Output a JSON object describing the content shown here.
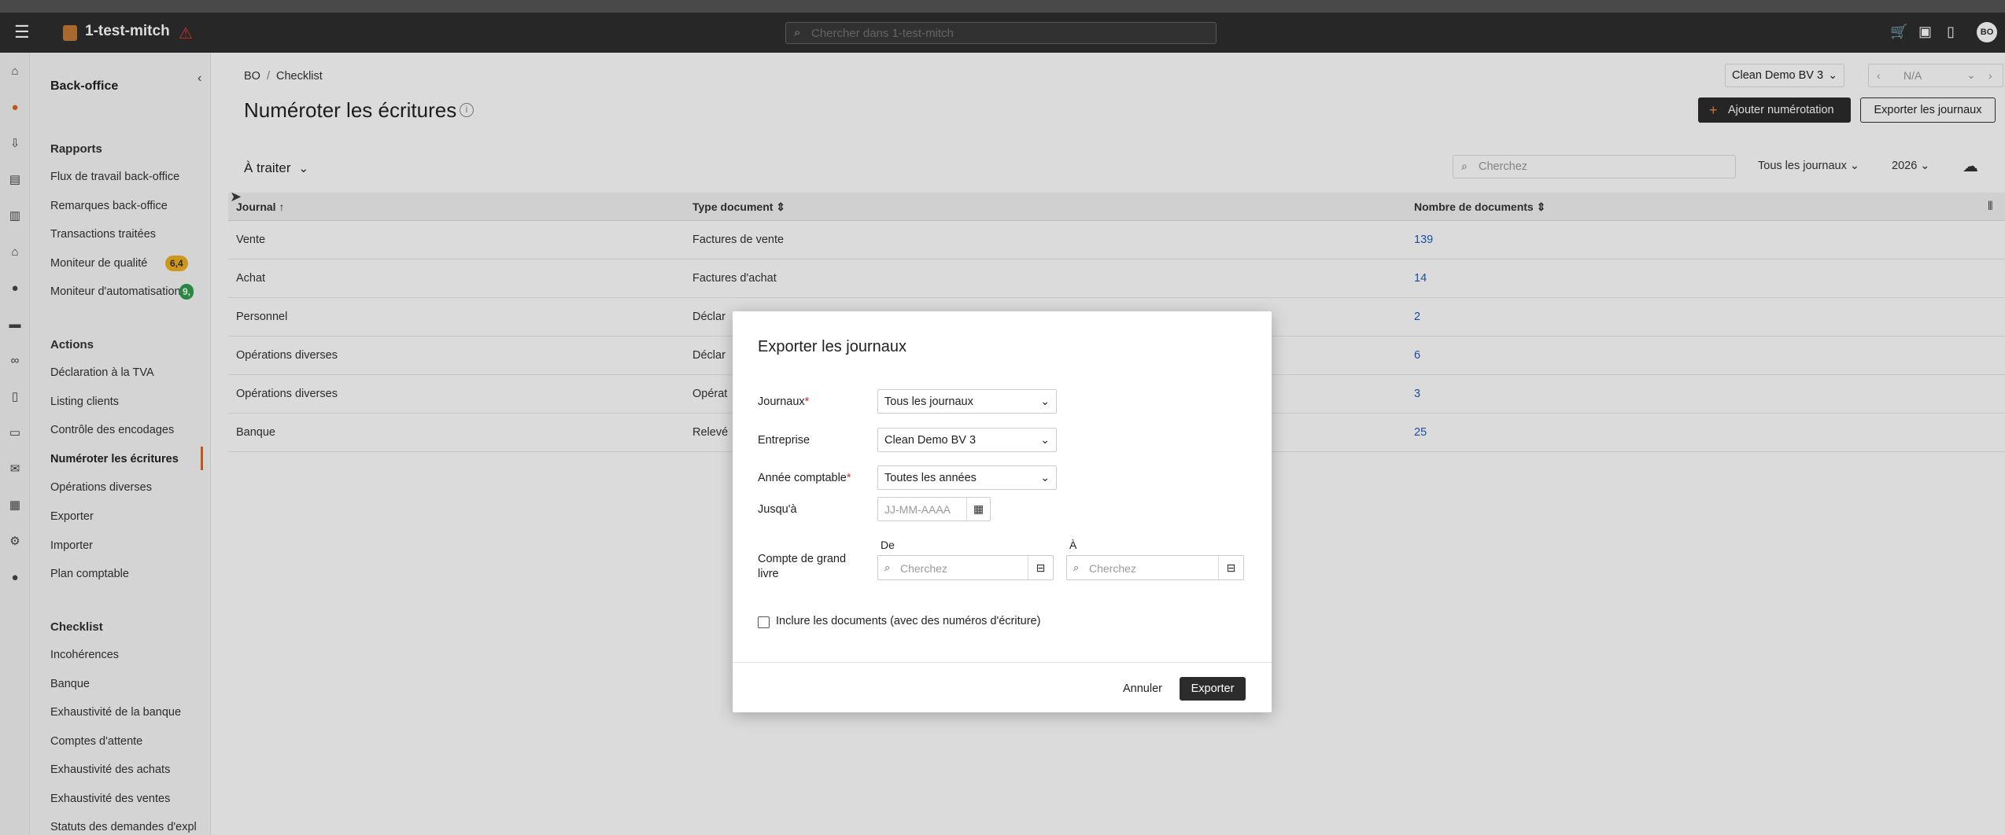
{
  "header": {
    "company_name": "1-test-mitch",
    "search_placeholder": "Chercher dans 1-test-mitch",
    "avatar_initials": "BO"
  },
  "sidebar": {
    "title": "Back-office",
    "sections": {
      "rapports": "Rapports",
      "actions": "Actions",
      "checklist": "Checklist"
    },
    "rapports_items": [
      "Flux de travail back-office",
      "Remarques back-office",
      "Transactions traitées",
      "Moniteur de qualité",
      "Moniteur d'automatisation"
    ],
    "quality_badge": "6,4",
    "automation_badge": "9,",
    "action_items": [
      "Déclaration à la TVA",
      "Listing clients",
      "Contrôle des encodages",
      "Numéroter les écritures",
      "Opérations diverses",
      "Exporter",
      "Importer",
      "Plan comptable"
    ],
    "checklist_items": [
      "Incohérences",
      "Banque",
      "Exhaustivité de la banque",
      "Comptes d'attente",
      "Exhaustivité des achats",
      "Exhaustivité des ventes",
      "Statuts des demandes d'expl"
    ]
  },
  "main": {
    "breadcrumb": [
      "BO",
      "Checklist"
    ],
    "title": "Numéroter les écritures",
    "company_select": "Clean Demo BV 3",
    "period": "N/A",
    "add_button": "Ajouter numérotation",
    "export_button": "Exporter les journaux",
    "filter_label": "À traiter",
    "table_search_placeholder": "Cherchez",
    "journal_filter": "Tous les journaux",
    "year_filter": "2026",
    "columns": [
      "Journal",
      "Type document",
      "Nombre de documents"
    ],
    "rows": [
      {
        "journal": "Vente",
        "type": "Factures de vente",
        "count": "139"
      },
      {
        "journal": "Achat",
        "type": "Factures d'achat",
        "count": "14"
      },
      {
        "journal": "Personnel",
        "type": "Déclar",
        "count": "2"
      },
      {
        "journal": "Opérations diverses",
        "type": "Déclar",
        "count": "6"
      },
      {
        "journal": "Opérations diverses",
        "type": "Opérat",
        "count": "3"
      },
      {
        "journal": "Banque",
        "type": "Relevé",
        "count": "25"
      }
    ]
  },
  "modal": {
    "title": "Exporter les journaux",
    "journaux_label": "Journaux",
    "journaux_value": "Tous les journaux",
    "entreprise_label": "Entreprise",
    "entreprise_value": "Clean Demo BV 3",
    "annee_label": "Année comptable",
    "annee_value": "Toutes les années",
    "jusqua_label": "Jusqu'à",
    "date_placeholder": "JJ-MM-AAAA",
    "compte_label": "Compte de grand livre",
    "de_label": "De",
    "a_label": "À",
    "search_placeholder": "Cherchez",
    "checkbox_label": "Inclure les documents (avec des numéros d'écriture)",
    "cancel": "Annuler",
    "export": "Exporter"
  },
  "colors": {
    "accent": "#e0641c",
    "header_bg": "#2e2e2e",
    "link": "#1e5ab8",
    "badge_quality": "#f2b01e",
    "badge_automation": "#2e9e4f"
  }
}
